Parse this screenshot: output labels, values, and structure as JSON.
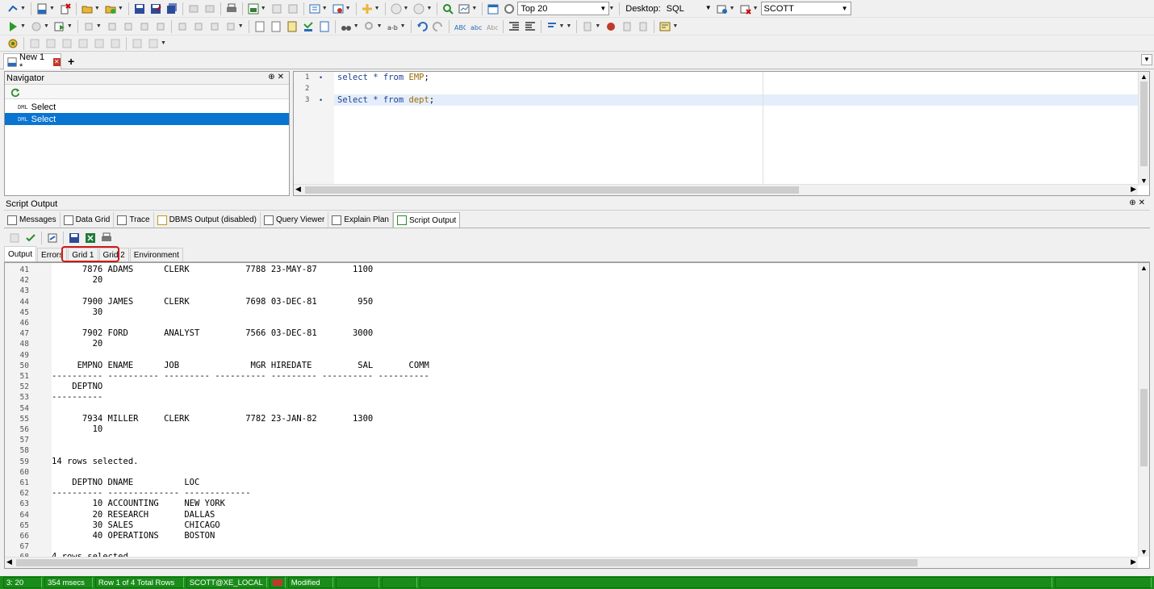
{
  "toolbar": {
    "top_rows_combo": "Top 20",
    "connection_label": "Desktop:",
    "connection_value": "SQL",
    "schema_combo": "SCOTT"
  },
  "doc_tab": {
    "label": "New 1 *",
    "add_label": "+"
  },
  "navigator": {
    "title": "Navigator",
    "items": [
      {
        "tag": "DML",
        "label": "Select"
      },
      {
        "tag": "DML",
        "label": "Select"
      }
    ]
  },
  "editor": {
    "lines": [
      {
        "num": "1",
        "kw1": "select * from ",
        "obj": "EMP",
        "end": ";"
      },
      {
        "num": "2",
        "kw1": "",
        "obj": "",
        "end": ""
      },
      {
        "num": "3",
        "kw1": "Select * from ",
        "obj": "dept",
        "end": ";"
      }
    ]
  },
  "output_panel": {
    "title": "Script Output",
    "tabs": [
      "Messages",
      "Data Grid",
      "Trace",
      "DBMS Output (disabled)",
      "Query Viewer",
      "Explain Plan",
      "Script Output"
    ],
    "subtabs": [
      "Output",
      "Errors",
      "Grid 1",
      "Grid 2",
      "Environment"
    ]
  },
  "output_lines": [
    {
      "n": "41",
      "t": "      7876 ADAMS      CLERK           7788 23-MAY-87       1100"
    },
    {
      "n": "42",
      "t": "        20"
    },
    {
      "n": "43",
      "t": ""
    },
    {
      "n": "44",
      "t": "      7900 JAMES      CLERK           7698 03-DEC-81        950"
    },
    {
      "n": "45",
      "t": "        30"
    },
    {
      "n": "46",
      "t": ""
    },
    {
      "n": "47",
      "t": "      7902 FORD       ANALYST         7566 03-DEC-81       3000"
    },
    {
      "n": "48",
      "t": "        20"
    },
    {
      "n": "49",
      "t": ""
    },
    {
      "n": "50",
      "t": "     EMPNO ENAME      JOB              MGR HIREDATE         SAL       COMM"
    },
    {
      "n": "51",
      "t": "---------- ---------- --------- ---------- --------- ---------- ----------"
    },
    {
      "n": "52",
      "t": "    DEPTNO"
    },
    {
      "n": "53",
      "t": "----------"
    },
    {
      "n": "54",
      "t": ""
    },
    {
      "n": "55",
      "t": "      7934 MILLER     CLERK           7782 23-JAN-82       1300"
    },
    {
      "n": "56",
      "t": "        10"
    },
    {
      "n": "57",
      "t": ""
    },
    {
      "n": "58",
      "t": ""
    },
    {
      "n": "59",
      "t": "14 rows selected."
    },
    {
      "n": "60",
      "t": ""
    },
    {
      "n": "61",
      "t": "    DEPTNO DNAME          LOC"
    },
    {
      "n": "62",
      "t": "---------- -------------- -------------"
    },
    {
      "n": "63",
      "t": "        10 ACCOUNTING     NEW YORK"
    },
    {
      "n": "64",
      "t": "        20 RESEARCH       DALLAS"
    },
    {
      "n": "65",
      "t": "        30 SALES          CHICAGO"
    },
    {
      "n": "66",
      "t": "        40 OPERATIONS     BOSTON"
    },
    {
      "n": "67",
      "t": ""
    },
    {
      "n": "68",
      "t": "4 rows selected."
    }
  ],
  "status": {
    "position": "3:  20",
    "time": "354 msecs",
    "rows": "Row 1 of 4 Total Rows",
    "connection": "SCOTT@XE_LOCAL",
    "state": "Modified"
  },
  "colors": {
    "status_green": "#1a8c1a",
    "selection_blue": "#0a74d1",
    "highlight_red": "#d01818"
  }
}
